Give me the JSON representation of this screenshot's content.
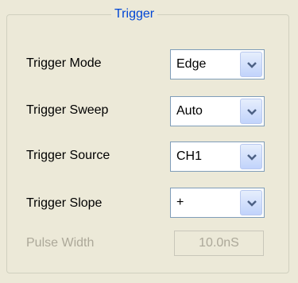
{
  "group_title": "Trigger",
  "rows": [
    {
      "label": "Trigger Mode",
      "value": "Edge"
    },
    {
      "label": "Trigger Sweep",
      "value": "Auto"
    },
    {
      "label": "Trigger Source",
      "value": "CH1"
    },
    {
      "label": "Trigger Slope",
      "value": "+"
    }
  ],
  "pulse_width": {
    "label": "Pulse Width",
    "value": "10.0nS"
  },
  "icons": {
    "dropdown": "chevron-down-icon"
  },
  "colors": {
    "background": "#ece9d8",
    "title": "#0046d5",
    "disabled_text": "#aca899",
    "combo_border": "#7f9db9"
  }
}
